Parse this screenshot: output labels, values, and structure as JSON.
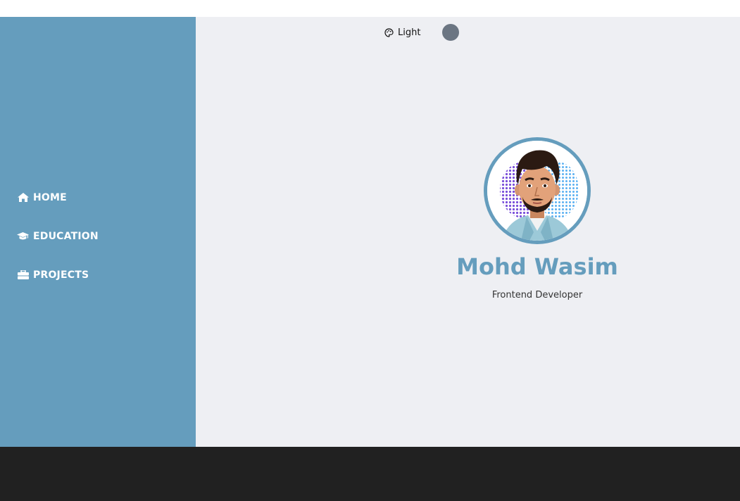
{
  "sidebar": {
    "items": [
      {
        "label": "HOME",
        "icon": "home-icon"
      },
      {
        "label": "EDUCATION",
        "icon": "graduation-cap-icon"
      },
      {
        "label": "PROJECTS",
        "icon": "briefcase-icon"
      }
    ]
  },
  "theme": {
    "label": "Light",
    "icon": "palette-icon",
    "dot_color": "#6b7582"
  },
  "profile": {
    "name": "Mohd Wasim",
    "role": "Frontend Developer",
    "avatar": "avatar-illustration"
  },
  "colors": {
    "accent": "#659dbd",
    "main_bg": "#eeeff3",
    "footer_bg": "#212121"
  }
}
